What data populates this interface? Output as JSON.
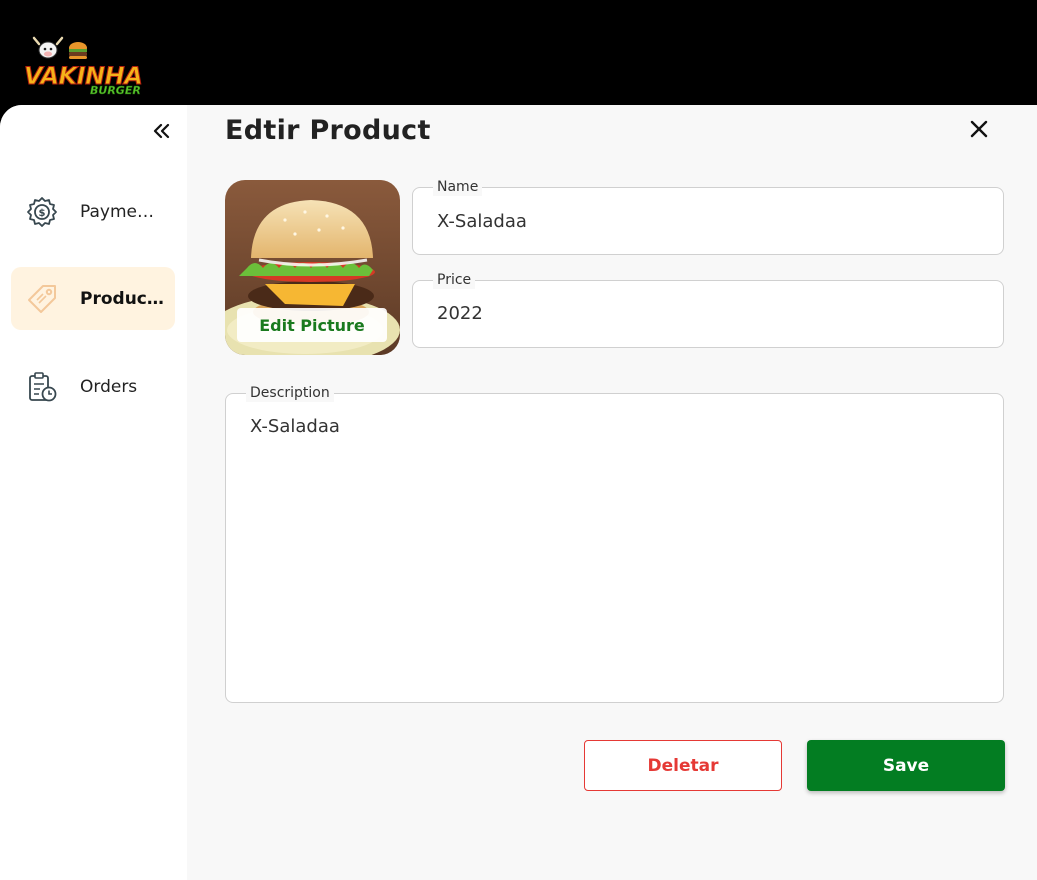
{
  "app": {
    "logo_text_main": "VAKINHA",
    "logo_text_sub": "BURGER"
  },
  "sidebar": {
    "collapse_icon": "double-chevron-left-icon",
    "items": [
      {
        "label": "Paymen…",
        "icon": "payment-gear-icon",
        "active": false
      },
      {
        "label": "Products",
        "icon": "price-tag-icon",
        "active": true
      },
      {
        "label": "Orders",
        "icon": "clipboard-clock-icon",
        "active": false
      }
    ]
  },
  "modal": {
    "title": "Edtir Product",
    "close_icon": "close-icon",
    "image": {
      "edit_label": "Edit Picture"
    },
    "fields": {
      "name": {
        "label": "Name",
        "value": "X-Saladaa"
      },
      "price": {
        "label": "Price",
        "value": "2022"
      },
      "description": {
        "label": "Description",
        "value": "X-Saladaa"
      }
    },
    "actions": {
      "delete_label": "Deletar",
      "save_label": "Save"
    }
  },
  "colors": {
    "accent_green": "#037d22",
    "danger_red": "#e53935",
    "active_nav_bg": "#fff3e0"
  }
}
